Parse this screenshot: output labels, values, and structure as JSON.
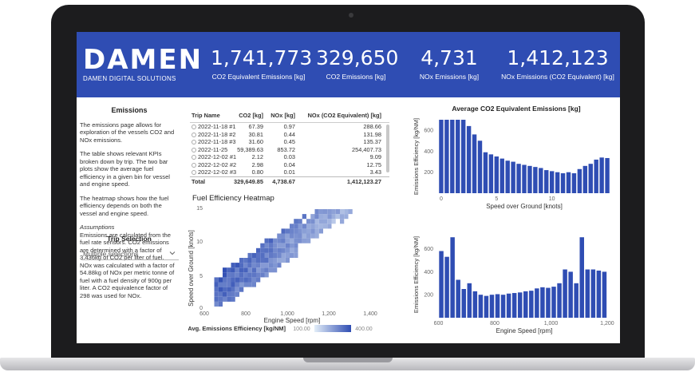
{
  "brand": {
    "logo": "DAMEN",
    "subtitle": "DAMEN DIGITAL SOLUTIONS"
  },
  "kpis": [
    {
      "value": "1,741,773",
      "label": "CO2 Equivalent Emissions [kg]"
    },
    {
      "value": "329,650",
      "label": "CO2 Emissions [kg]"
    },
    {
      "value": "4,731",
      "label": "NOx Emissions [kg]"
    },
    {
      "value": "1,412,123",
      "label": "NOx Emissions (CO2 Equivalent) [kg]"
    }
  ],
  "sidebar": {
    "title": "Emissions",
    "p1": "The emissions page allows for exploration of the vessels CO2 and NOx emissions.",
    "p2": "The table shows relevant KPIs broken down by trip. The two bar plots show the average fuel efficiency in a given bin for vessel and engine speed.",
    "p3": "The heatmap shows how the fuel efficiency depends on both the vessel and engine speed.",
    "assumptions_title": "Assumptions",
    "assumptions": "Emissions are calculated from the fuel rate sensors. CO2 emissions are determined with a factor of 3.436kg of CO2 per liter of fuel. NOx was calculated with a factor of 54.88kg of NOx per metric tonne of fuel with a fuel density of 900g per liter. A CO2 equivalence factor of 298 was used for NOx.",
    "trip_selection_title": "Trip Selection",
    "trip_selection_value": "Multiple selections"
  },
  "table": {
    "headers": [
      "Trip Name",
      "CO2 [kg]",
      "NOx [kg]",
      "NOx (CO2 Equivalent) [kg]"
    ],
    "rows": [
      [
        "2022-11-18 #1",
        "67.39",
        "0.97",
        "288.66"
      ],
      [
        "2022-11-18 #2",
        "30.81",
        "0.44",
        "131.98"
      ],
      [
        "2022-11-18 #3",
        "31.60",
        "0.45",
        "135.37"
      ],
      [
        "2022-11-25",
        "59,389.63",
        "853.72",
        "254,407.73"
      ],
      [
        "2022-12-02 #1",
        "2.12",
        "0.03",
        "9.09"
      ],
      [
        "2022-12-02 #2",
        "2.98",
        "0.04",
        "12.75"
      ],
      [
        "2022-12-02 #3",
        "0.80",
        "0.01",
        "3.43"
      ]
    ],
    "total": [
      "Total",
      "329,649.85",
      "4,738.67",
      "1,412,123.27"
    ]
  },
  "heatmap": {
    "title": "Fuel Efficiency Heatmap",
    "xlabel": "Engine Speed [rpm]",
    "ylabel": "Speed over Ground [knots]",
    "x_ticks": [
      "600",
      "800",
      "1,000",
      "1,200",
      "1,400"
    ],
    "y_ticks": [
      "0",
      "5",
      "10",
      "15"
    ],
    "legend_label": "Avg. Emissions Efficiency [kg/NM]",
    "legend_min": "100.00",
    "legend_max": "400.00",
    "color_low": "#e3eef8",
    "color_high": "#2f4db3"
  },
  "chart_data": [
    {
      "type": "bar",
      "title": "Average CO2 Equivalent Emissions [kg]",
      "xlabel": "Speed over Ground [knots]",
      "ylabel": "Emissions Efficiency [kg/NM]",
      "x_ticks": [
        "0",
        "5",
        "10"
      ],
      "y_ticks": [
        "200",
        "400",
        "600"
      ],
      "xlim": [
        -0.5,
        15.5
      ],
      "ylim": [
        0,
        700
      ],
      "x": [
        0,
        0.5,
        1,
        1.5,
        2,
        2.5,
        3,
        3.5,
        4,
        4.5,
        5,
        5.5,
        6,
        6.5,
        7,
        7.5,
        8,
        8.5,
        9,
        9.5,
        10,
        10.5,
        11,
        11.5,
        12,
        12.5,
        13,
        13.5,
        14,
        14.5,
        15
      ],
      "values": [
        700,
        700,
        700,
        700,
        700,
        640,
        560,
        500,
        390,
        370,
        350,
        330,
        310,
        300,
        280,
        270,
        260,
        250,
        240,
        220,
        210,
        200,
        190,
        200,
        190,
        230,
        260,
        280,
        320,
        340,
        335
      ]
    },
    {
      "type": "bar",
      "xlabel": "Engine Speed [rpm]",
      "ylabel": "Emissions Efficiency [kg/NM]",
      "x_ticks": [
        "600",
        "800",
        "1,000",
        "1,200"
      ],
      "y_ticks": [
        "200",
        "400",
        "600"
      ],
      "xlim": [
        590,
        1220
      ],
      "ylim": [
        0,
        750
      ],
      "x": [
        610,
        630,
        650,
        670,
        690,
        710,
        730,
        750,
        770,
        790,
        810,
        830,
        850,
        870,
        890,
        910,
        930,
        950,
        970,
        990,
        1010,
        1030,
        1050,
        1070,
        1090,
        1110,
        1130,
        1150,
        1170,
        1190
      ],
      "values": [
        580,
        530,
        700,
        330,
        250,
        300,
        230,
        200,
        190,
        200,
        205,
        200,
        210,
        215,
        220,
        230,
        235,
        255,
        265,
        260,
        270,
        300,
        420,
        400,
        300,
        700,
        420,
        420,
        410,
        400
      ]
    }
  ]
}
